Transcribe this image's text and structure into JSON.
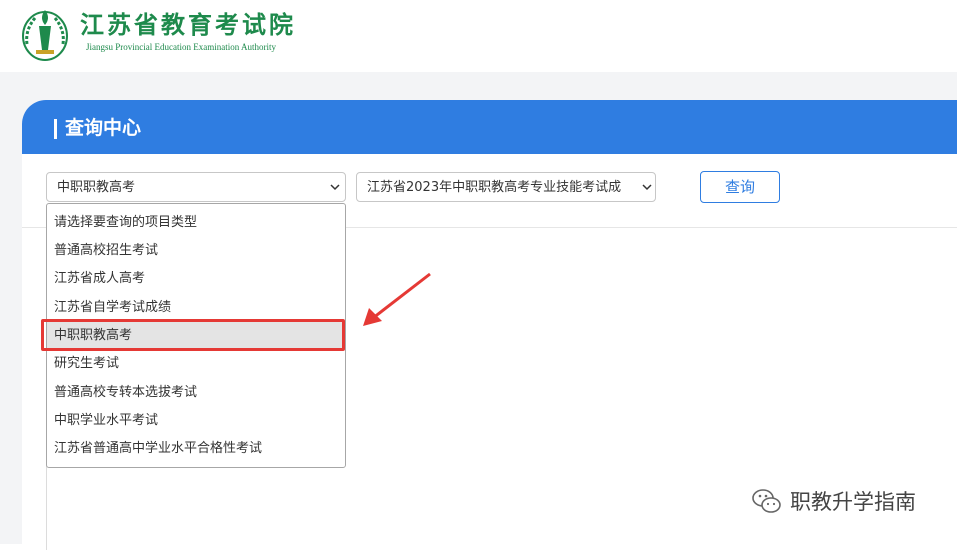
{
  "header": {
    "org_name_cn": "江苏省教育考试院",
    "org_name_en": "Jiangsu Provincial Education Examination Authority",
    "brand_color": "#1e8a4c"
  },
  "panel": {
    "title": "查询中心",
    "accent_color": "#2f7de1"
  },
  "form": {
    "project_type_select": {
      "value": "中职职教高考",
      "options": [
        "请选择要查询的项目类型",
        "普通高校招生考试",
        "江苏省成人高考",
        "江苏省自学考试成绩",
        "中职职教高考",
        "研究生考试",
        "普通高校专转本选拔考试",
        "中职学业水平考试",
        "江苏省普通高中学业水平合格性考试"
      ],
      "selected_index": 4
    },
    "exam_select": {
      "value": "江苏省2023年中职职教高考专业技能考试成"
    },
    "query_button": "查询"
  },
  "annotation": {
    "highlight_color": "#e53935",
    "arrow_color": "#e53935"
  },
  "watermark": {
    "text": "职教升学指南",
    "icon": "wechat-icon"
  }
}
